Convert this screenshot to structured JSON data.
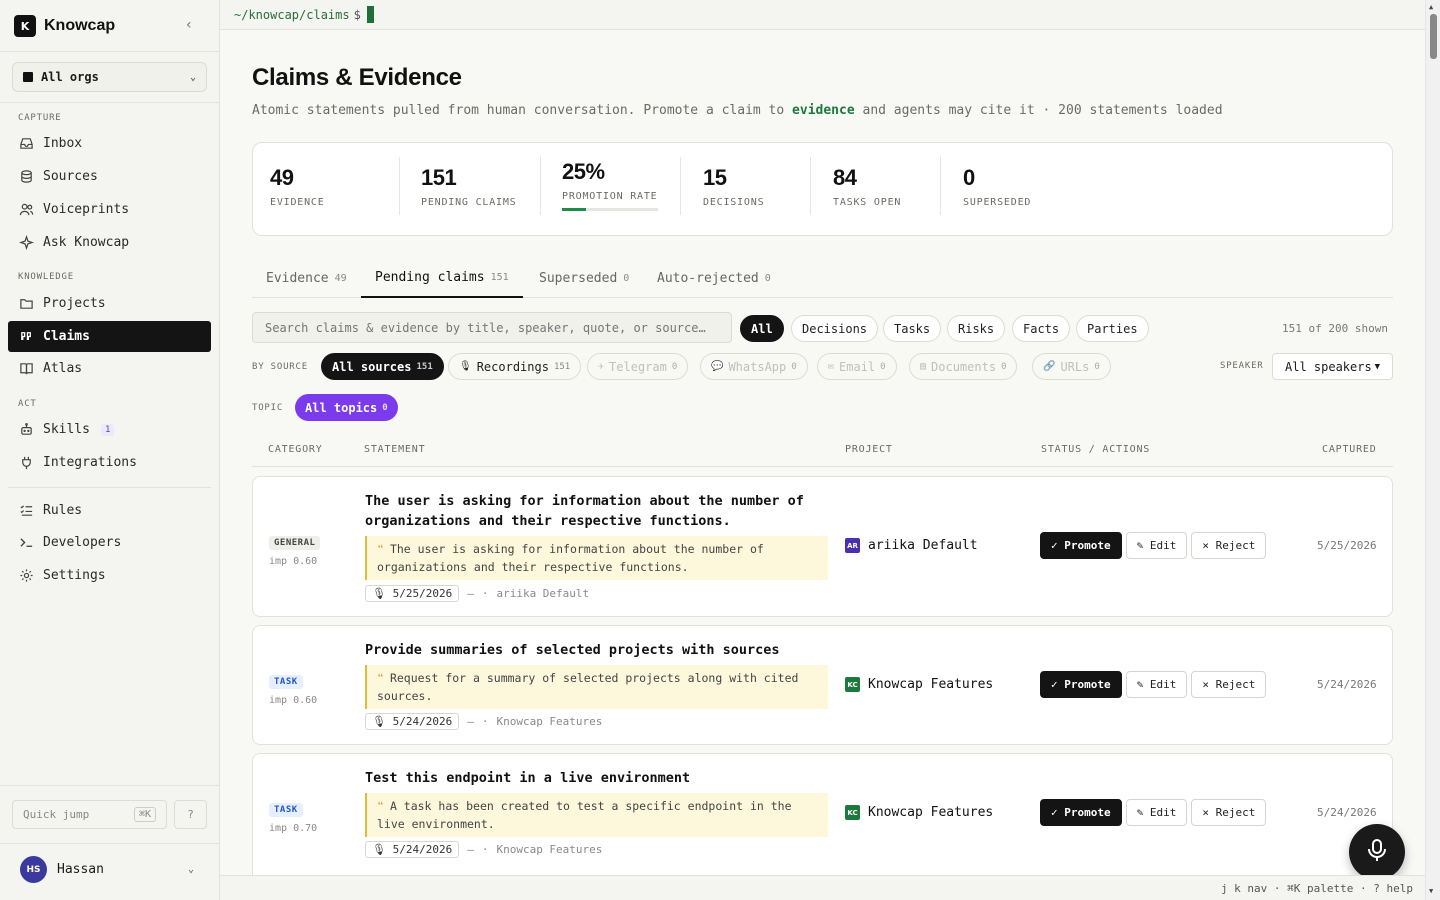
{
  "sidebar": {
    "brand": {
      "logo": "K",
      "name": "Knowcap",
      "collapse_icon": "‹"
    },
    "org": {
      "label": "All orgs"
    },
    "sections": {
      "capture": "CAPTURE",
      "knowledge": "KNOWLEDGE",
      "act": "ACT"
    },
    "items": {
      "inbox": "Inbox",
      "sources": "Sources",
      "voiceprints": "Voiceprints",
      "ask": "Ask Knowcap",
      "projects": "Projects",
      "claims": "Claims",
      "atlas": "Atlas",
      "skills": "Skills",
      "skills_badge": "1",
      "integrations": "Integrations",
      "rules": "Rules",
      "developers": "Developers",
      "settings": "Settings"
    },
    "quick_jump": {
      "label": "Quick jump",
      "shortcut": "⌘K",
      "help": "?"
    },
    "user": {
      "initials": "HS",
      "name": "Hassan"
    }
  },
  "topbar": {
    "path": "~/knowcap/claims",
    "prompt": "$"
  },
  "page": {
    "title": "Claims & Evidence",
    "subtitle_pre": "Atomic statements pulled from human conversation. Promote a claim to ",
    "subtitle_em": "evidence",
    "subtitle_post": " and agents may cite it · 200 statements loaded"
  },
  "stats": {
    "evidence": {
      "value": "49",
      "label": "EVIDENCE"
    },
    "pending": {
      "value": "151",
      "label": "PENDING CLAIMS"
    },
    "rate": {
      "value": "25%",
      "label": "PROMOTION RATE",
      "fraction": 0.25
    },
    "decisions": {
      "value": "15",
      "label": "DECISIONS"
    },
    "tasks": {
      "value": "84",
      "label": "TASKS OPEN"
    },
    "superseded": {
      "value": "0",
      "label": "SUPERSEDED"
    }
  },
  "tabs": {
    "evidence": {
      "label": "Evidence",
      "count": "49"
    },
    "pending": {
      "label": "Pending claims",
      "count": "151"
    },
    "superseded": {
      "label": "Superseded",
      "count": "0"
    },
    "rejected": {
      "label": "Auto-rejected",
      "count": "0"
    }
  },
  "filters": {
    "search_placeholder": "Search claims & evidence by title, speaker, quote, or source…",
    "types": {
      "all": "All",
      "decisions": "Decisions",
      "tasks": "Tasks",
      "risks": "Risks",
      "facts": "Facts",
      "parties": "Parties"
    },
    "shown": "151 of 200 shown",
    "by_source_label": "BY SOURCE",
    "sources": {
      "all": {
        "label": "All sources",
        "count": "151"
      },
      "recordings": {
        "label": "Recordings",
        "count": "151"
      },
      "telegram": {
        "label": "Telegram",
        "count": "0"
      },
      "whatsapp": {
        "label": "WhatsApp",
        "count": "0"
      },
      "email": {
        "label": "Email",
        "count": "0"
      },
      "documents": {
        "label": "Documents",
        "count": "0"
      },
      "urls": {
        "label": "URLs",
        "count": "0"
      }
    },
    "speaker_label": "SPEAKER",
    "speaker_value": "All speakers",
    "topic_label": "TOPIC",
    "topic": {
      "label": "All topics",
      "count": "0"
    }
  },
  "table": {
    "headers": {
      "category": "CATEGORY",
      "statement": "STATEMENT",
      "project": "PROJECT",
      "status": "STATUS / ACTIONS",
      "captured": "CAPTURED"
    },
    "rows": [
      {
        "category": "GENERAL",
        "importance": "imp 0.60",
        "statement": "The user is asking for information about the number of organizations and their respective functions.",
        "quote": "The user is asking for information about the number of organizations and their respective functions.",
        "date": "5/25/2026",
        "dash": "—",
        "dot": "·",
        "meta_project": "ariika Default",
        "project_logo": "AR",
        "project": "ariika Default",
        "project_color": "#4b2fb0",
        "captured": "5/25/2026"
      },
      {
        "category": "TASK",
        "importance": "imp 0.60",
        "statement": "Provide summaries of selected projects with sources",
        "quote": "Request for a summary of selected projects along with cited sources.",
        "date": "5/24/2026",
        "dash": "—",
        "dot": "·",
        "meta_project": "Knowcap Features",
        "project_logo": "KC",
        "project": "Knowcap Features",
        "project_color": "#1d7a3c",
        "captured": "5/24/2026"
      },
      {
        "category": "TASK",
        "importance": "imp 0.70",
        "statement": "Test this endpoint in a live environment",
        "quote": "A task has been created to test a specific endpoint in the live environment.",
        "date": "5/24/2026",
        "dash": "—",
        "dot": "·",
        "meta_project": "Knowcap Features",
        "project_logo": "KC",
        "project": "Knowcap Features",
        "project_color": "#1d7a3c",
        "captured": "5/24/2026"
      }
    ],
    "actions": {
      "promote": "✓ Promote",
      "edit": "✎ Edit",
      "reject": "× Reject"
    }
  },
  "footer": {
    "hint": "j k nav · ⌘K palette · ? help"
  }
}
